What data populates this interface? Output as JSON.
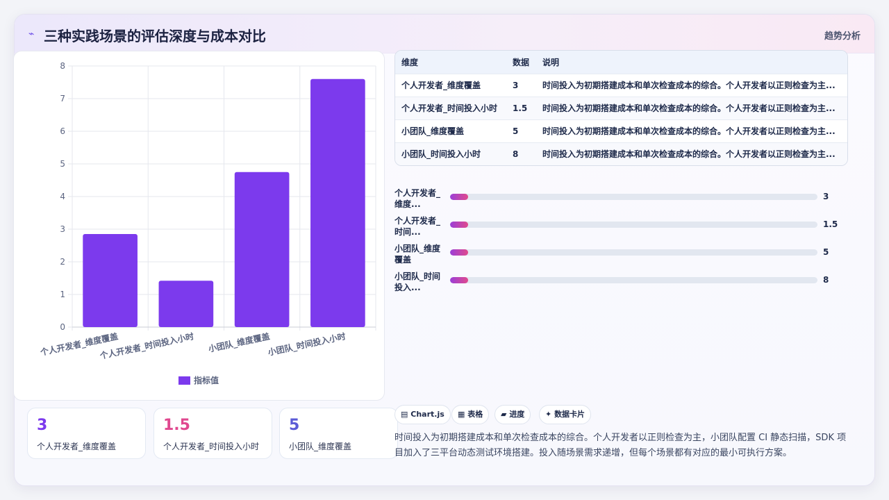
{
  "header": {
    "logo_glyph": "⌁",
    "title": "三种实践场景的评估深度与成本对比",
    "tag": "趋势分析"
  },
  "chart_data": {
    "type": "bar",
    "categories": [
      "个人开发者_维度覆盖",
      "个人开发者_时间投入小时",
      "小团队_维度覆盖",
      "小团队_时间投入小时"
    ],
    "series": [
      {
        "name": "指标值",
        "values": [
          2.85,
          1.42,
          4.75,
          7.6
        ],
        "color": "#7c3aed"
      }
    ],
    "ylim": [
      0,
      8
    ],
    "yticks": [
      0,
      1,
      2,
      3,
      4,
      5,
      6,
      7,
      8
    ],
    "grid": true,
    "legend": "bottom"
  },
  "stats": [
    {
      "value": "3",
      "label": "个人开发者_维度覆盖",
      "color": "#7c3aed"
    },
    {
      "value": "1.5",
      "label": "个人开发者_时间投入小时",
      "color": "#e0488f"
    },
    {
      "value": "5",
      "label": "小团队_维度覆盖",
      "color": "#5b5bd6"
    }
  ],
  "table": {
    "headers": [
      "维度",
      "数据",
      "说明"
    ],
    "rows": [
      [
        "个人开发者_维度覆盖",
        "3",
        "时间投入为初期搭建成本和单次检查成本的综合。个人开发者以正则检查为主..."
      ],
      [
        "个人开发者_时间投入小时",
        "1.5",
        "时间投入为初期搭建成本和单次检查成本的综合。个人开发者以正则检查为主..."
      ],
      [
        "小团队_维度覆盖",
        "5",
        "时间投入为初期搭建成本和单次检查成本的综合。个人开发者以正则检查为主..."
      ],
      [
        "小团队_时间投入小时",
        "8",
        "时间投入为初期搭建成本和单次检查成本的综合。个人开发者以正则检查为主..."
      ]
    ]
  },
  "progress": [
    {
      "label": "个人开发者_维度...",
      "value": "3",
      "fraction": 0.05
    },
    {
      "label": "个人开发者_时间...",
      "value": "1.5",
      "fraction": 0.05
    },
    {
      "label": "小团队_维度覆盖",
      "value": "5",
      "fraction": 0.05
    },
    {
      "label": "小团队_时间投入...",
      "value": "8",
      "fraction": 0.05
    }
  ],
  "chips": [
    {
      "icon": "▤",
      "label": "Chart.js"
    },
    {
      "icon": "▦",
      "label": "表格"
    },
    {
      "icon": "▰",
      "label": "进度"
    },
    {
      "icon": "✦",
      "label": "数据卡片"
    }
  ],
  "description": "时间投入为初期搭建成本和单次检查成本的综合。个人开发者以正则检查为主，小团队配置 CI 静态扫描，SDK 项目加入了三平台动态测试环境搭建。投入随场景需求递增，但每个场景都有对应的最小可执行方案。"
}
